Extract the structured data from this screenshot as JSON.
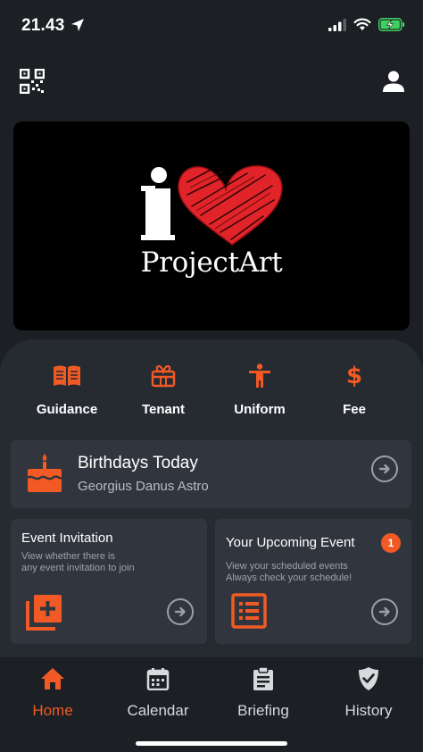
{
  "status_bar": {
    "time": "21.43",
    "icons": [
      "location-arrow-icon",
      "signal-icon",
      "wifi-icon",
      "battery-charging-icon"
    ]
  },
  "topbar": {
    "left_icon": "qr-code-icon",
    "right_icon": "user-icon"
  },
  "banner": {
    "letter": "i",
    "brand": "ProjectArt"
  },
  "quick_actions": [
    {
      "label": "Guidance",
      "icon": "book-open-icon"
    },
    {
      "label": "Tenant",
      "icon": "gift-box-icon"
    },
    {
      "label": "Uniform",
      "icon": "person-standing-icon"
    },
    {
      "label": "Fee",
      "icon": "dollar-icon"
    }
  ],
  "birthdays": {
    "title": "Birthdays Today",
    "subtitle": "Georgius Danus Astro",
    "icon": "birthday-cake-icon"
  },
  "event_invitation": {
    "title": "Event Invitation",
    "description_line1": "View whether there is",
    "description_line2": "any event invitation to join",
    "icon": "add-box-icon"
  },
  "upcoming_event": {
    "title": "Your Upcoming Event",
    "badge": "1",
    "description_line1": "View your scheduled events",
    "description_line2": "Always check your schedule!",
    "icon": "list-icon"
  },
  "bottom_nav": [
    {
      "label": "Home",
      "icon": "home-icon",
      "active": true
    },
    {
      "label": "Calendar",
      "icon": "calendar-icon",
      "active": false
    },
    {
      "label": "Briefing",
      "icon": "clipboard-icon",
      "active": false
    },
    {
      "label": "History",
      "icon": "shield-check-icon",
      "active": false
    }
  ],
  "colors": {
    "accent": "#f15a24",
    "background": "#1c1f24",
    "panel": "#262a31",
    "card": "#31363e",
    "heart": "#e0242a"
  }
}
